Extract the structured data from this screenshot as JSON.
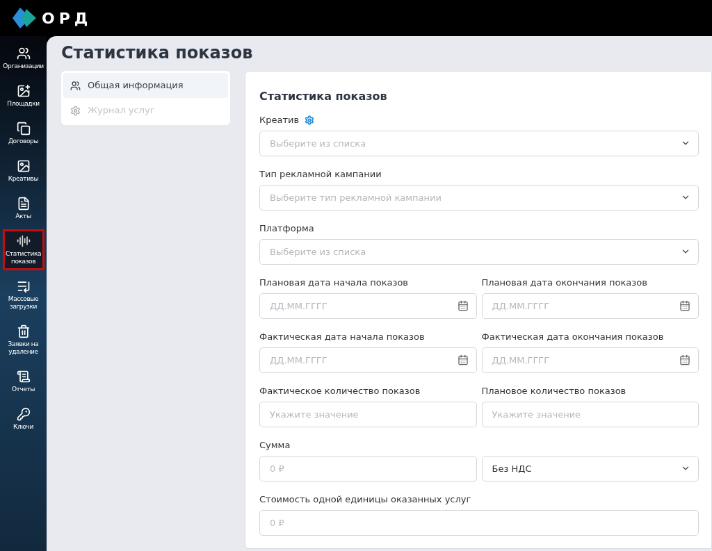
{
  "brand": {
    "name": "ОРД"
  },
  "nav": [
    {
      "label": "Организации",
      "selected": false
    },
    {
      "label": "Площадки",
      "selected": false
    },
    {
      "label": "Договоры",
      "selected": false
    },
    {
      "label": "Креативы",
      "selected": false
    },
    {
      "label": "Акты",
      "selected": false
    },
    {
      "label": "Статистика показов",
      "selected": true
    },
    {
      "label": "Массовые загрузки",
      "selected": false
    },
    {
      "label": "Заявки на удаление",
      "selected": false
    },
    {
      "label": "Отчеты",
      "selected": false
    },
    {
      "label": "Ключи",
      "selected": false
    }
  ],
  "page_title": "Статистика показов",
  "sections": [
    {
      "label": "Общая информация",
      "selected": true,
      "disabled": false
    },
    {
      "label": "Журнал услуг",
      "selected": false,
      "disabled": true
    }
  ],
  "form": {
    "title": "Статистика показов",
    "rows": [
      {
        "fields": [
          {
            "label": "Креатив",
            "has_settings": true,
            "kind": "select",
            "placeholder": "Выберите из списка"
          }
        ]
      },
      {
        "fields": [
          {
            "label": "Тип рекламной кампании",
            "kind": "select",
            "placeholder": "Выберите тип рекламной кампании"
          }
        ]
      },
      {
        "fields": [
          {
            "label": "Платформа",
            "kind": "select",
            "placeholder": "Выберите из списка"
          }
        ]
      },
      {
        "fields": [
          {
            "label": "Плановая дата начала показов",
            "kind": "date",
            "placeholder": "ДД.ММ.ГГГГ"
          },
          {
            "label": "Плановая дата окончания показов",
            "kind": "date",
            "placeholder": "ДД.ММ.ГГГГ"
          }
        ]
      },
      {
        "fields": [
          {
            "label": "Фактическая дата начала показов",
            "kind": "date",
            "placeholder": "ДД.ММ.ГГГГ"
          },
          {
            "label": "Фактическая дата окончания показов",
            "kind": "date",
            "placeholder": "ДД.ММ.ГГГГ"
          }
        ]
      },
      {
        "fields": [
          {
            "label": "Фактическое количество показов",
            "kind": "text",
            "placeholder": "Укажите значение"
          },
          {
            "label": "Плановое количество показов",
            "kind": "text",
            "placeholder": "Укажите значение"
          }
        ]
      },
      {
        "fields": [
          {
            "label": "Сумма",
            "kind": "text",
            "placeholder": "0 ₽"
          },
          {
            "kind": "select",
            "value": "Без НДС"
          }
        ]
      },
      {
        "fields": [
          {
            "label": "Стоимость одной единицы оказанных услуг",
            "kind": "text",
            "placeholder": "0 ₽"
          }
        ]
      }
    ]
  }
}
